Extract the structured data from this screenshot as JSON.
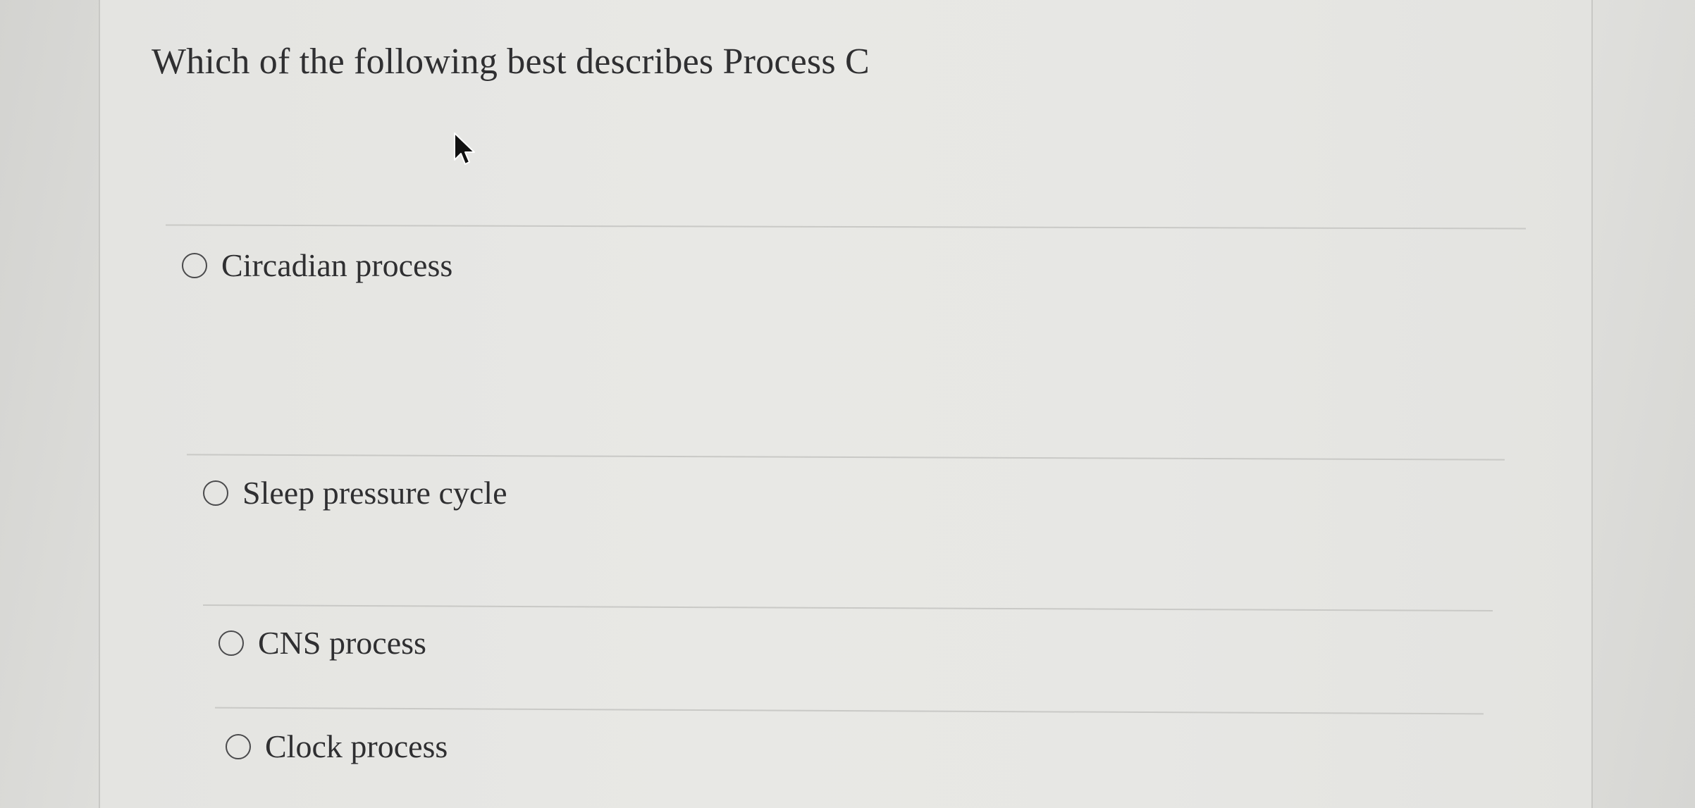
{
  "question": {
    "text": "Which of the following best describes Process C"
  },
  "options": [
    {
      "label": "Circadian process",
      "selected": false
    },
    {
      "label": "Sleep pressure cycle",
      "selected": false
    },
    {
      "label": "CNS process",
      "selected": false
    },
    {
      "label": "Clock process",
      "selected": false
    }
  ],
  "icons": {
    "cursor": "mouse-pointer-icon",
    "radio": "radio-button-icon"
  },
  "colors": {
    "text": "#2f2f31",
    "background": "#e6e6e3",
    "divider": "#c9c9c6"
  }
}
